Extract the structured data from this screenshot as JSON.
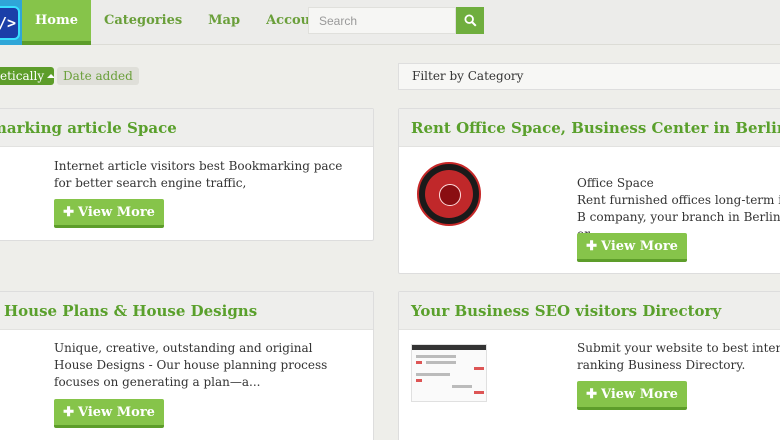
{
  "nav": {
    "items": [
      "Home",
      "Categories",
      "Map",
      "Account"
    ]
  },
  "search": {
    "placeholder": "Search",
    "icon": "search-icon"
  },
  "sort": {
    "active_label": "etically",
    "date_label": "Date added"
  },
  "filter": {
    "label": "Filter by Category"
  },
  "listings": [
    {
      "title": "marking article Space",
      "description": "Internet article visitors best Bookmarking pace for better search engine traffic,",
      "button": "View More"
    },
    {
      "title": "Rent Office Space, Business Center in Berlin Mitte",
      "subtitle": "Office Space",
      "description": "Rent furnished offices long-term in B company, your branch in Berlin, or...",
      "button": "View More"
    },
    {
      "title": "House Plans & House Designs",
      "description": "Unique, creative, outstanding and original House Designs - Our house planning process focuses on generating a plan—a...",
      "button": "View More"
    },
    {
      "title": "Your Business SEO visitors Directory",
      "description": "Submit your website to best internet ranking Business Directory.",
      "button": "View More"
    }
  ],
  "colors": {
    "accent": "#86c44a",
    "accent_dark": "#5d9d2a",
    "title_green": "#5aa02c"
  }
}
